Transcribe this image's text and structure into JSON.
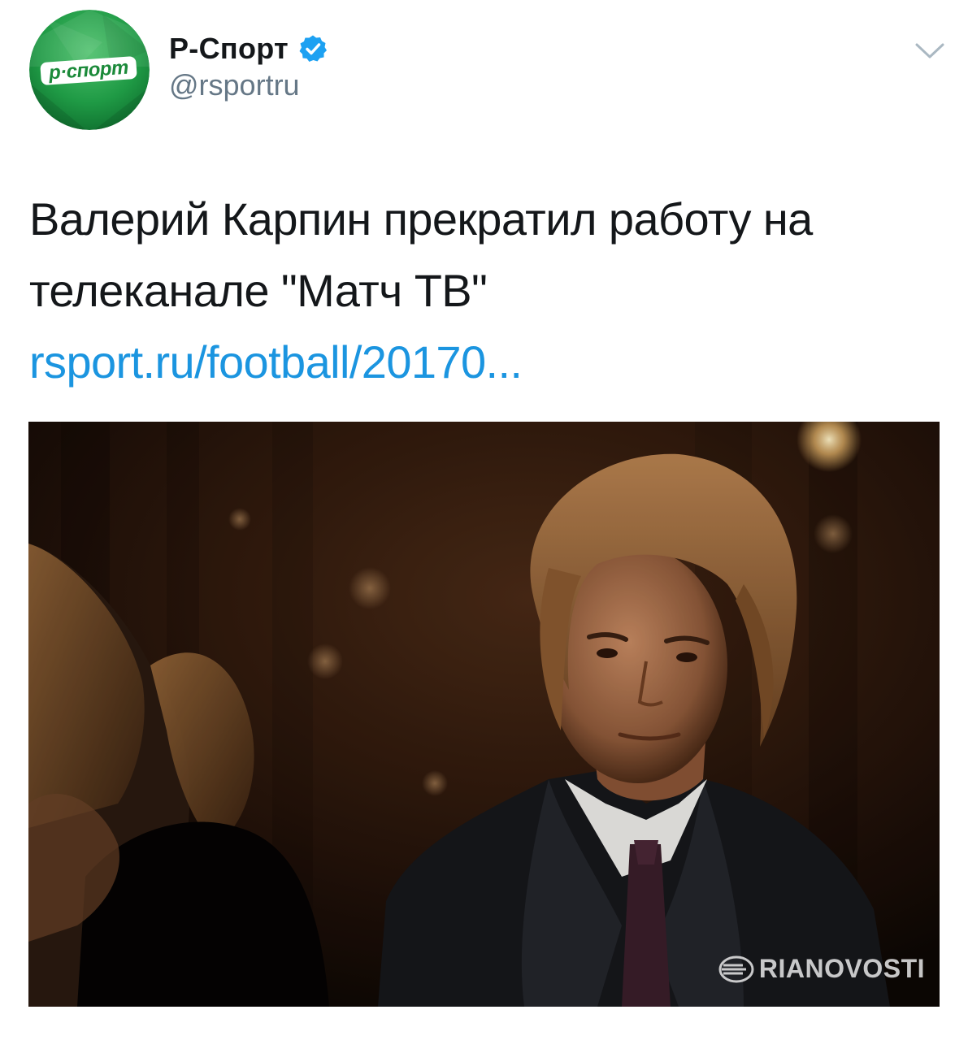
{
  "tweet": {
    "author": {
      "display_name": "Р-Спорт",
      "handle": "@rsportru",
      "avatar_label": "р·спорт",
      "verified": true,
      "avatar_colors": {
        "dark": "#0f6e2e",
        "mid": "#1f9a45",
        "light": "#4cc06b"
      }
    },
    "text": "Валерий Карпин прекратил работу на телеканале \"Матч ТВ\"",
    "link_text": "rsport.ru/football/20170...",
    "media": {
      "watermark": "RIANOVOSTI"
    },
    "icons": {
      "verified": "verified-badge-icon",
      "menu": "chevron-down-icon",
      "watermark_logo": "ria-logo-icon"
    },
    "colors": {
      "link": "#1b95e0",
      "verified": "#1da1f2",
      "handle": "#657786",
      "text": "#14171a"
    }
  }
}
